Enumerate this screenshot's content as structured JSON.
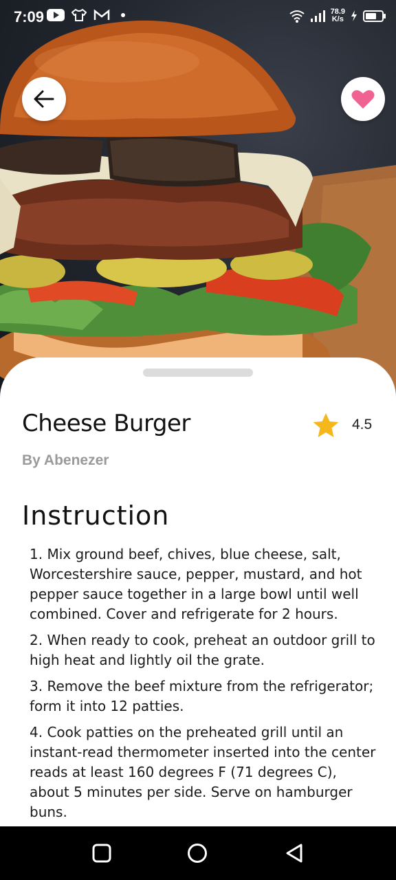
{
  "status_bar": {
    "time": "7:09",
    "net_speed_value": "78.9",
    "net_speed_unit": "K/s",
    "battery_level": 0.7,
    "notification_icons": [
      "youtube-icon",
      "shirt-icon",
      "gmail-icon",
      "dot-icon"
    ],
    "system_icons": [
      "wifi-icon",
      "signal-icon",
      "charging-icon",
      "battery-icon"
    ]
  },
  "header": {
    "back_icon": "arrow-left-icon",
    "favorite_icon": "heart-icon",
    "favorite_color": "#f06292"
  },
  "recipe": {
    "title": "Cheese Burger",
    "rating": "4.5",
    "rating_icon": "star-icon",
    "star_color": "#f4b81c",
    "author": "By Abenezer"
  },
  "instructions": {
    "heading": "Instruction",
    "steps": [
      "1. Mix ground beef, chives, blue cheese, salt, Worcestershire sauce, pepper, mustard, and hot pepper sauce together in a large bowl until well combined. Cover and refrigerate for 2 hours.",
      "2. When ready to cook, preheat an outdoor grill to high heat and lightly oil the grate.",
      "3. Remove the beef mixture from the refrigerator; form it into 12 patties.",
      "4. Cook patties on the preheated grill until an instant-read thermometer inserted into the center reads at least 160 degrees F (71 degrees C), about 5 minutes per side. Serve on hamburger buns."
    ]
  },
  "nav_bar": {
    "buttons": [
      "recents-square-icon",
      "home-circle-icon",
      "back-triangle-icon"
    ]
  }
}
